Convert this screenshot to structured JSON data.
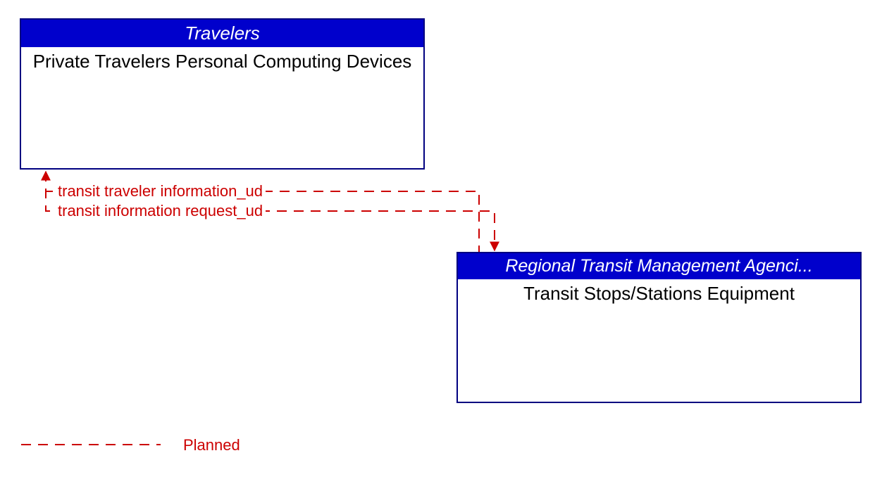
{
  "boxes": {
    "travelers": {
      "header": "Travelers",
      "body": "Private Travelers Personal Computing Devices"
    },
    "transit": {
      "header": "Regional Transit Management Agenci...",
      "body": "Transit Stops/Stations Equipment"
    }
  },
  "flows": {
    "to_travelers": "transit traveler information_ud",
    "to_transit": "transit information request_ud"
  },
  "legend": {
    "planned": "Planned"
  },
  "colors": {
    "header_bg": "#0000cc",
    "border": "#000080",
    "flow": "#cc0000"
  }
}
